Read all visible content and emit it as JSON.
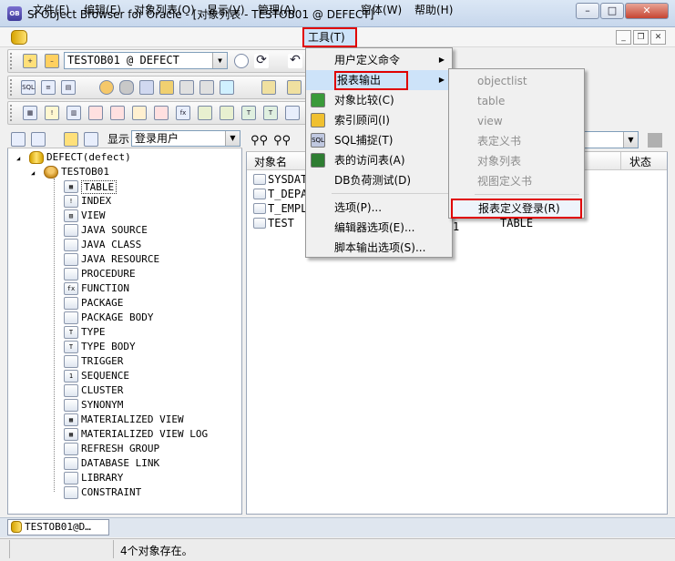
{
  "window": {
    "title": "SI Object Browser for Oracle - [对象列表 - TESTOB01 @ DEFECT]",
    "app_icon_text": "OB"
  },
  "menubar": {
    "items": [
      "文件(F)",
      "编辑(E)",
      "对象列表(O)",
      "显示(V)",
      "管理(A)",
      "工具(T)",
      "窗体(W)",
      "帮助(H)"
    ]
  },
  "toolbar": {
    "connection": "TESTOB01 @ DEFECT"
  },
  "left_panel": {
    "show_label": "显示",
    "show_value": "登录用户"
  },
  "tree": {
    "root": "DEFECT(defect)",
    "user": "TESTOB01",
    "items": [
      "TABLE",
      "INDEX",
      "VIEW",
      "JAVA SOURCE",
      "JAVA CLASS",
      "JAVA RESOURCE",
      "PROCEDURE",
      "FUNCTION",
      "PACKAGE",
      "PACKAGE BODY",
      "TYPE",
      "TYPE BODY",
      "TRIGGER",
      "SEQUENCE",
      "CLUSTER",
      "SYNONYM",
      "MATERIALIZED VIEW",
      "MATERIALIZED VIEW LOG",
      "REFRESH GROUP",
      "DATABASE LINK",
      "LIBRARY",
      "CONSTRAINT"
    ]
  },
  "object_list": {
    "headers": {
      "name": "对象名",
      "status": "状态"
    },
    "rows": [
      {
        "name": "SYSDAT",
        "type": ""
      },
      {
        "name": "T_DEPA",
        "type": ""
      },
      {
        "name": "T_EMPL",
        "type": ""
      },
      {
        "name": "TEST",
        "type": "TABLE"
      }
    ],
    "partial_col": "1"
  },
  "tools_menu": {
    "items": [
      "用户定义命令",
      "报表输出",
      "对象比较(C)",
      "索引顾问(I)",
      "SQL捕捉(T)",
      "表的访问表(A)",
      "DB负荷测试(D)",
      "选项(P)...",
      "编辑器选项(E)...",
      "脚本输出选项(S)..."
    ]
  },
  "report_submenu": {
    "items": [
      "objectlist",
      "table",
      "view",
      "表定义书",
      "对象列表",
      "视图定义书",
      "报表定义登录(R)"
    ]
  },
  "tabs": {
    "doc": "TESTOB01@D…"
  },
  "status": {
    "text": "4个对象存在。"
  },
  "colors": {
    "highlight_box": "#e00000",
    "menu_hover": "#cde3f9"
  }
}
